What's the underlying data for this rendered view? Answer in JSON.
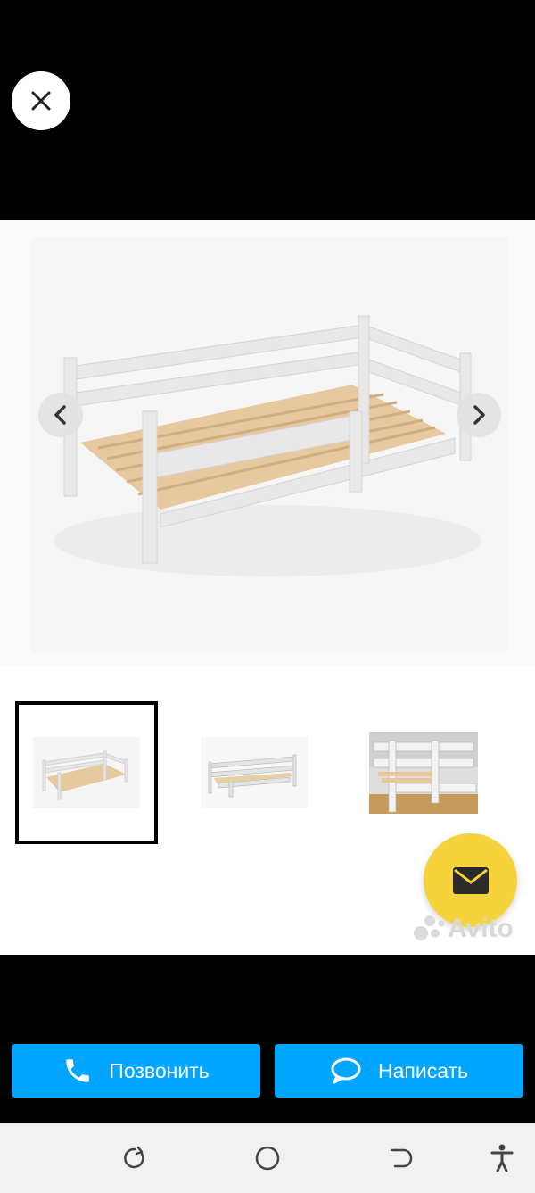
{
  "viewer": {
    "close_icon": "close-icon",
    "prev_icon": "chevron-left-icon",
    "next_icon": "chevron-right-icon"
  },
  "gallery": {
    "thumbnails": [
      {
        "icon": "bed-photo-thumbnail",
        "active": true
      },
      {
        "icon": "bed-photo-thumbnail",
        "active": false
      },
      {
        "icon": "bed-photo-thumbnail",
        "active": false
      }
    ],
    "message_icon": "envelope-icon",
    "watermark_text": "Avito"
  },
  "actions": {
    "call_label": "Позвонить",
    "write_label": "Написать",
    "call_icon": "phone-icon",
    "write_icon": "chat-bubble-icon"
  },
  "colors": {
    "accent": "#00a6ff",
    "fab": "#f6d33a"
  },
  "system_nav": {
    "icons": [
      "recent-apps-icon",
      "home-icon",
      "back-icon",
      "accessibility-icon"
    ]
  }
}
